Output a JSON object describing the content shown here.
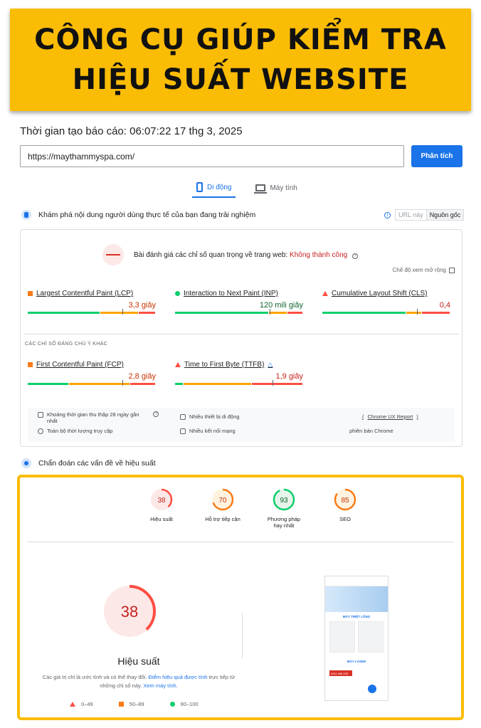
{
  "banner": {
    "line1": "CÔNG CỤ GIÚP KIỂM TRA",
    "line2": "HIỆU SUẤT WEBSITE"
  },
  "report_time": "Thời gian tạo báo cáo: 06:07:22 17 thg 3, 2025",
  "url_input": {
    "value": "https://maythammyspa.com/"
  },
  "analyze_button": "Phân tích",
  "device_tabs": [
    {
      "label": "Di động",
      "active": true
    },
    {
      "label": "Máy tính",
      "active": false
    }
  ],
  "field_section": {
    "title": "Khám phá nội dung người dùng thực tế của bạn đang trải nghiệm",
    "source_tabs": [
      "URL này",
      "Nguồn gốc"
    ],
    "assessment_label": "Bài đánh giá các chỉ số quan trọng về trang web:",
    "assessment_result": "Không thành công",
    "expand_label": "Chế độ xem mở rộng",
    "metrics": [
      {
        "label": "Largest Contentful Paint (LCP)",
        "value": "3,3 giây",
        "status": "needs-improvement",
        "good": 0.57,
        "ni": 0.3,
        "poor": 0.13,
        "marker": 0.74
      },
      {
        "label": "Interaction to Next Paint (INP)",
        "value": "120 mili giây",
        "status": "good",
        "good": 0.74,
        "ni": 0.14,
        "poor": 0.12,
        "marker": 0.74
      },
      {
        "label": "Cumulative Layout Shift (CLS)",
        "value": "0,4",
        "status": "poor",
        "good": 0.66,
        "ni": 0.12,
        "poor": 0.22,
        "marker": 0.74
      }
    ],
    "other_title": "CÁC CHỈ SỐ ĐÁNG CHÚ Ý KHÁC",
    "other_metrics": [
      {
        "label": "First Contentful Paint (FCP)",
        "value": "2,8 giây",
        "status": "needs-improvement",
        "good": 0.32,
        "ni": 0.48,
        "poor": 0.2,
        "marker": 0.74
      },
      {
        "label": "Time to First Byte (TTFB)",
        "value": "1,9 giây",
        "status": "poor",
        "good": 0.06,
        "ni": 0.54,
        "poor": 0.4,
        "marker": 0.76
      }
    ],
    "footer": {
      "period": "Khoảng thời gian thu thập 28 ngày gần nhất",
      "devices": "Nhiều thiết bị di động",
      "report": "Chrome UX Report",
      "duration": "Toàn bộ thời lượng truy cập",
      "network": "Nhiều kết nối mạng",
      "chrome": "phiên bản Chrome"
    }
  },
  "diagnostics": {
    "title": "Chẩn đoán các vấn đề về hiệu suất",
    "scores": [
      {
        "value": "38",
        "label": "Hiệu suất",
        "color": "#ff4e42",
        "bg": "#fce8e6",
        "text": "#c5221f",
        "fraction": 0.38
      },
      {
        "value": "70",
        "label": "Hỗ trợ tiếp cận",
        "color": "#fa7b17",
        "bg": "#fff3e0",
        "text": "#c33300",
        "fraction": 0.7
      },
      {
        "value": "93",
        "label": "Phương pháp hay nhất",
        "color": "#0cce6b",
        "bg": "#e6f4ea",
        "text": "#0d652d",
        "fraction": 0.93
      },
      {
        "value": "85",
        "label": "SEO",
        "color": "#fa7b17",
        "bg": "#fff3e0",
        "text": "#c33300",
        "fraction": 0.85
      }
    ],
    "main_score": {
      "value": "38",
      "label": "Hiệu suất",
      "fraction": 0.38
    },
    "note_part1": "Các giá trị chỉ là ước tính và có thể thay đổi.",
    "note_link1": "Điểm hiệu quả được tính",
    "note_part2": "trực tiếp từ những chỉ số này.",
    "note_link2": "Xem máy tính.",
    "legend": [
      "0–49",
      "50–89",
      "90–100"
    ],
    "thumbnail": {
      "heading": "MÁY TRIỆT LÔNG",
      "section2": "MÁY LASER",
      "phone": "0911.456.233"
    }
  }
}
